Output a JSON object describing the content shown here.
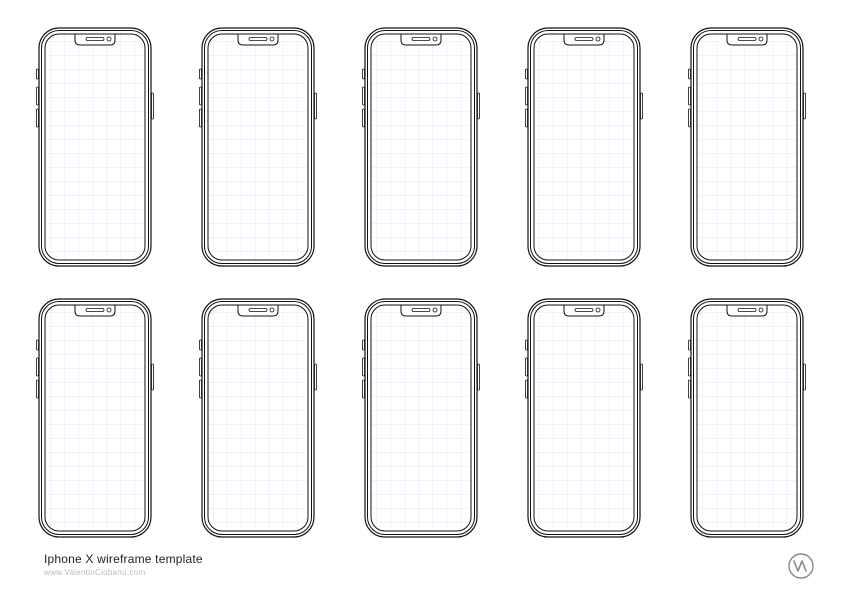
{
  "template": {
    "title": "Iphone X wireframe template",
    "subtitle": "www.ValentinCiobanu.com",
    "grid": {
      "rows": 2,
      "cols": 5,
      "count": 10
    },
    "colors": {
      "outline": "#111111",
      "grid_line": "#cfe3f7",
      "background": "#ffffff",
      "subtext": "#bbbbbb"
    }
  }
}
